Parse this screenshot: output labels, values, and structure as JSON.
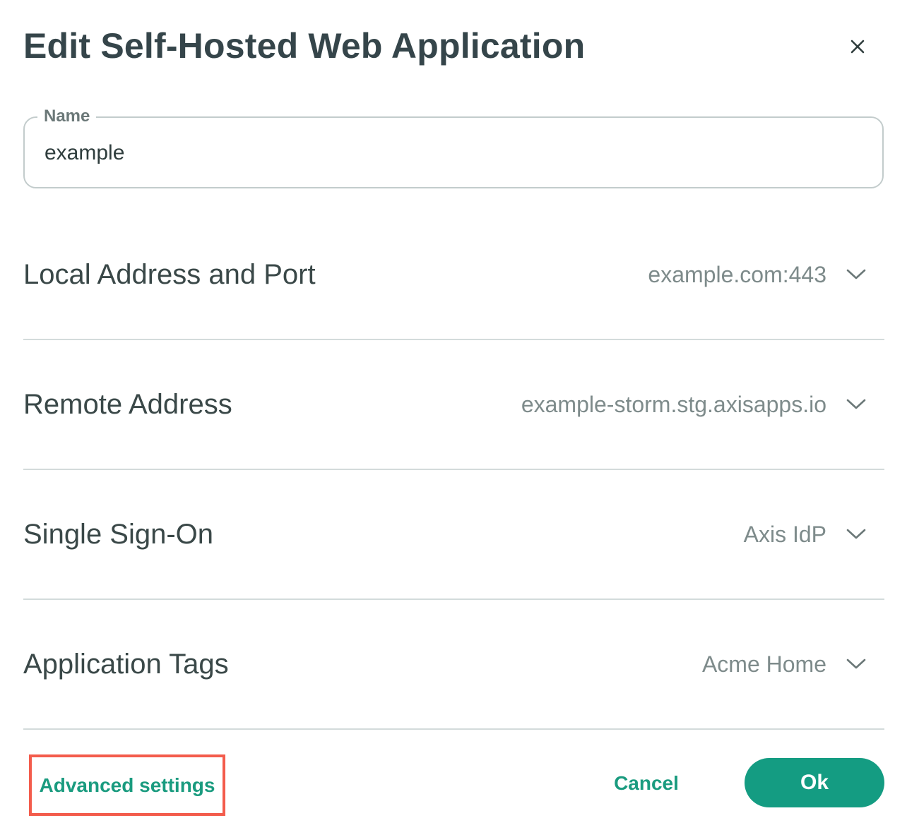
{
  "dialog": {
    "title": "Edit Self-Hosted Web Application",
    "close_icon": "close-icon"
  },
  "name_field": {
    "label": "Name",
    "value": "example"
  },
  "rows": [
    {
      "label": "Local Address and Port",
      "value": "example.com:443",
      "icon": "chevron-down-icon"
    },
    {
      "label": "Remote Address",
      "value": "example-storm.stg.axisapps.io",
      "icon": "chevron-down-icon"
    },
    {
      "label": "Single Sign-On",
      "value": "Axis IdP",
      "icon": "chevron-down-icon"
    },
    {
      "label": "Application Tags",
      "value": "Acme Home",
      "icon": "chevron-down-icon"
    }
  ],
  "footer": {
    "advanced_label": "Advanced settings",
    "cancel_label": "Cancel",
    "ok_label": "Ok"
  },
  "colors": {
    "accent": "#149c82",
    "link": "#1a9b7f",
    "highlight_border": "#f35c4c"
  }
}
